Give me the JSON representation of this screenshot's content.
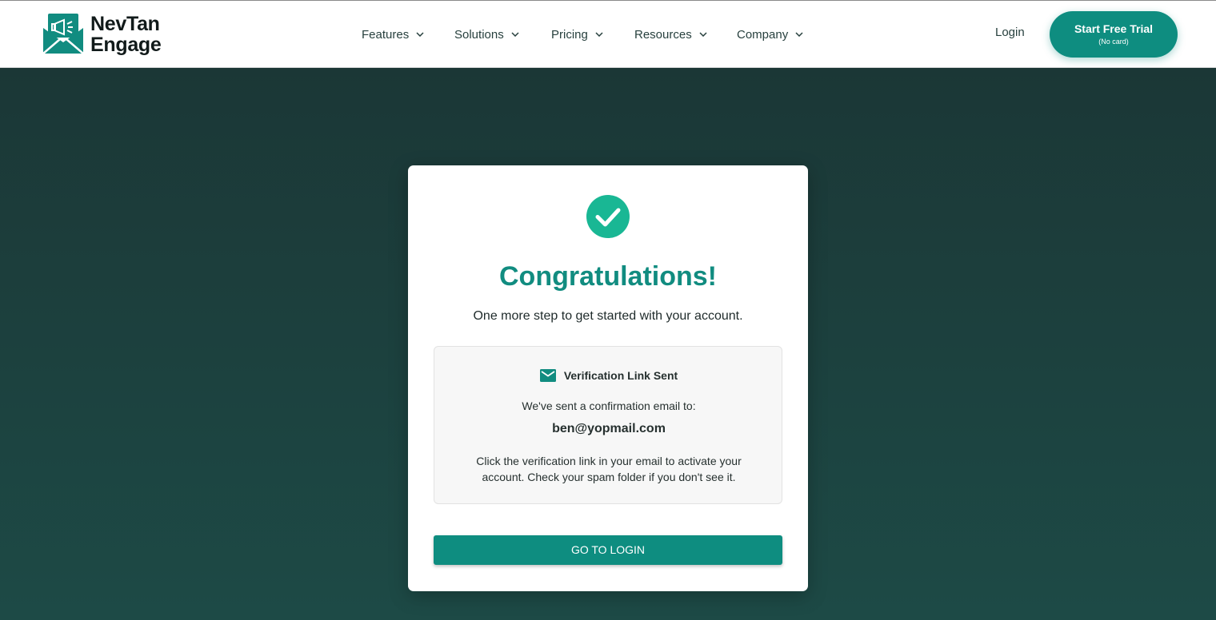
{
  "brand": {
    "line1": "NevTan",
    "line2": "Engage",
    "accent_color": "#118c80"
  },
  "nav": {
    "items": [
      {
        "label": "Features",
        "icon": "chevron-down-icon"
      },
      {
        "label": "Solutions",
        "icon": "chevron-down-icon"
      },
      {
        "label": "Pricing",
        "icon": "chevron-down-icon"
      },
      {
        "label": "Resources",
        "icon": "chevron-down-icon"
      },
      {
        "label": "Company",
        "icon": "chevron-down-icon"
      }
    ],
    "login_label": "Login",
    "trial_button": {
      "label": "Start Free Trial",
      "sublabel": "(No card)"
    }
  },
  "card": {
    "icon": "check-circle-icon",
    "title": "Congratulations!",
    "subtitle": "One more step to get started with your account.",
    "info": {
      "icon": "mail-icon",
      "heading": "Verification Link Sent",
      "line": "We've sent a confirmation email to:",
      "email": "ben@yopmail.com",
      "note": "Click the verification link in your email to activate your account. Check your spam folder if you don't see it."
    },
    "button_label": "GO TO LOGIN"
  },
  "colors": {
    "hero_background": "#1c3b39",
    "button": "#0e8d80",
    "check": "#19b794"
  }
}
